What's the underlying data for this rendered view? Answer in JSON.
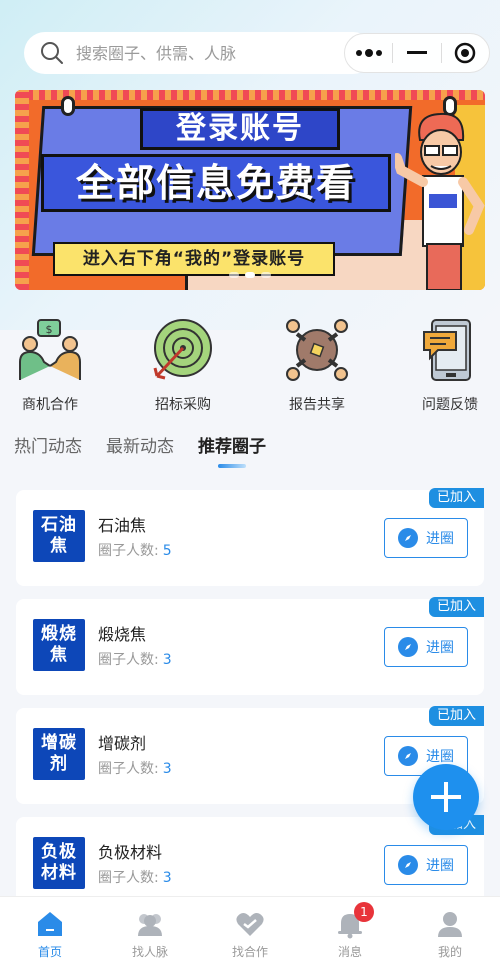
{
  "search": {
    "placeholder": "搜索圈子、供需、人脉"
  },
  "banner": {
    "line1": "登录账号",
    "line2": "全部信息免费看",
    "line3": "进入右下角“我的”登录账号"
  },
  "quick_menu": [
    {
      "label": "商机合作",
      "icon": "handshake-icon"
    },
    {
      "label": "招标采购",
      "icon": "target-icon"
    },
    {
      "label": "报告共享",
      "icon": "share-people-icon"
    },
    {
      "label": "问题反馈",
      "icon": "feedback-phone-icon"
    }
  ],
  "tabs": [
    {
      "label": "热门动态"
    },
    {
      "label": "最新动态"
    },
    {
      "label": "推荐圈子",
      "active": true
    }
  ],
  "cards": [
    {
      "name": "石油焦",
      "logo_text": "石油焦",
      "members_label": "圈子人数:",
      "members": "5",
      "badge": "已加入",
      "button": "进圈"
    },
    {
      "name": "煅烧焦",
      "logo_text": "煅烧焦",
      "members_label": "圈子人数:",
      "members": "3",
      "badge": "已加入",
      "button": "进圈"
    },
    {
      "name": "增碳剂",
      "logo_text": "增碳剂",
      "members_label": "圈子人数:",
      "members": "3",
      "badge": "已加入",
      "button": "进圈"
    },
    {
      "name": "负极材料",
      "logo_text": "负极材料",
      "members_label": "圈子人数:",
      "members": "3",
      "badge": "已加入",
      "button": "进圈"
    }
  ],
  "tabbar": [
    {
      "label": "首页",
      "icon": "home-icon",
      "active": true
    },
    {
      "label": "找人脉",
      "icon": "people-icon"
    },
    {
      "label": "找合作",
      "icon": "cooperation-icon"
    },
    {
      "label": "消息",
      "icon": "bell-icon",
      "badge": "1"
    },
    {
      "label": "我的",
      "icon": "user-icon"
    }
  ],
  "colors": {
    "accent": "#2a8be8",
    "badge_red": "#e8343a",
    "logo_blue": "#0d47b8"
  }
}
